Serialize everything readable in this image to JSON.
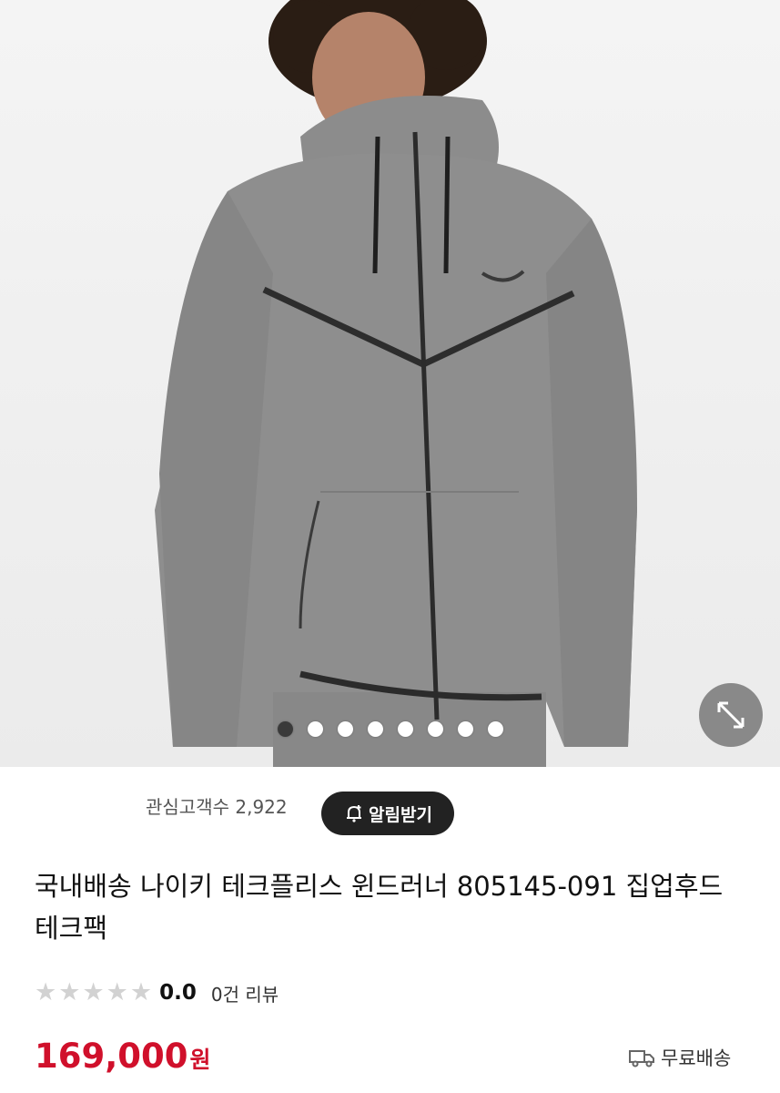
{
  "gallery": {
    "image_alt": "Nike Tech Fleece windrunner hoodie, grey",
    "dot_count": 8,
    "active_index": 0,
    "expand_icon": "expand-arrows-icon"
  },
  "watch": {
    "label": "관심고객수 2,922"
  },
  "alarm_button": {
    "label": "알림받기",
    "icon": "bell-plus-icon"
  },
  "product": {
    "title": "국내배송 나이키 테크플리스 윈드러너 805145-091 집업후드 테크팩"
  },
  "rating": {
    "stars_filled": 0,
    "stars_total": 5,
    "score": "0.0",
    "review_text": "0건 리뷰"
  },
  "price": {
    "amount": "169,000",
    "currency": "원",
    "color": "#d0102b"
  },
  "shipping": {
    "label": "무료배송",
    "icon": "truck-icon"
  }
}
